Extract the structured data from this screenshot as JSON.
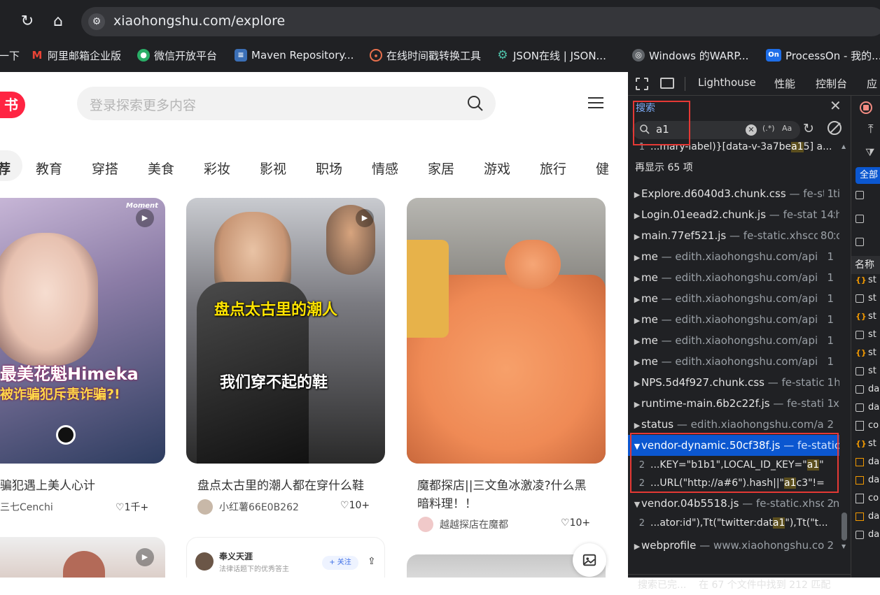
{
  "browser": {
    "url": "xiaohongshu.com/explore",
    "bookmarks": [
      {
        "label": "一下",
        "icon": "bookmark-icon"
      },
      {
        "label": "阿里邮箱企业版",
        "icon": "mail-icon"
      },
      {
        "label": "微信开放平台",
        "icon": "wechat-icon"
      },
      {
        "label": "Maven Repository...",
        "icon": "maven-icon"
      },
      {
        "label": "在线时间戳转换工具",
        "icon": "clock-icon"
      },
      {
        "label": "JSON在线 | JSON...",
        "icon": "json-icon"
      },
      {
        "label": "Windows 的WARP...",
        "icon": "globe-icon"
      },
      {
        "label": "ProcessOn - 我的...",
        "icon": "processon-icon"
      }
    ]
  },
  "site": {
    "logo": "书",
    "search_placeholder": "登录探索更多内容",
    "categories": [
      "荐",
      "教育",
      "穿搭",
      "美食",
      "彩妆",
      "影视",
      "职场",
      "情感",
      "家居",
      "游戏",
      "旅行",
      "健"
    ],
    "cards": [
      {
        "title": "骗犯遇上美人心计",
        "author": "三七Cenchi",
        "likes": "1千+",
        "img_caption_1": "最美花魁Himeka",
        "img_caption_2": "被诈骗犯斥责诈骗?!",
        "tag": "Moment"
      },
      {
        "title": "盘点太古里的潮人都在穿什么鞋",
        "author": "小红薯66E0B262",
        "likes": "10+",
        "img_caption_1": "盘点太古里的潮人",
        "img_caption_2": "我们穿不起的鞋"
      },
      {
        "title_line1": "魔都探店||三文鱼冰激凌?什么黑",
        "title_line2": "暗料理！！",
        "author": "越越探店在魔都",
        "likes": "10+"
      }
    ],
    "promo": {
      "author": "奉义天涯",
      "subtitle": "法律话题下的优秀答主",
      "follow": "+ 关注"
    }
  },
  "devtools": {
    "tabs": [
      "Lighthouse",
      "性能",
      "控制台",
      "应"
    ],
    "search": {
      "title": "搜索",
      "query": "a1",
      "regex_label": "(.*)",
      "case_label": "Aa",
      "top_match": {
        "line": "1",
        "pre": "...mary-label)}[data-v-3a7be",
        "hit": "a1",
        "post": "5] a..."
      },
      "more_label": "再显示 65 项",
      "files": [
        {
          "name": "Explore.d6040d3.chunk.css",
          "url": "— fe-static.xhscdn.com",
          "count": "1"
        },
        {
          "name": "Login.01eead2.chunk.js",
          "url": "— fe-static.xhscdn.com",
          "count": "14"
        },
        {
          "name": "main.77ef521.js",
          "url": "— fe-static.xhscdn.com",
          "count": "80"
        },
        {
          "name": "me",
          "url": "— edith.xiaohongshu.com/api",
          "count": "1"
        },
        {
          "name": "me",
          "url": "— edith.xiaohongshu.com/api",
          "count": "1"
        },
        {
          "name": "me",
          "url": "— edith.xiaohongshu.com/api",
          "count": "1"
        },
        {
          "name": "me",
          "url": "— edith.xiaohongshu.com/api",
          "count": "1"
        },
        {
          "name": "me",
          "url": "— edith.xiaohongshu.com/api",
          "count": "1"
        },
        {
          "name": "me",
          "url": "— edith.xiaohongshu.com/api",
          "count": "1"
        },
        {
          "name": "NPS.5d4f927.chunk.css",
          "url": "— fe-static.xhscdn.com",
          "count": "1"
        },
        {
          "name": "runtime-main.6b2c22f.js",
          "url": "— fe-static.xhscdn.com",
          "count": "1"
        },
        {
          "name": "status",
          "url": "— edith.xiaohongshu.com/api",
          "count": "2"
        }
      ],
      "selected_file": {
        "name": "vendor-dynamic.50cf38f.js",
        "url": "— fe-static.xhscdn.com"
      },
      "selected_matches": [
        {
          "line": "2",
          "pre": "...KEY=\"b1b1\",LOCAL_ID_KEY=\"",
          "hit": "a1",
          "post": "\""
        },
        {
          "line": "2",
          "pre": "...URL(\"http://a#6\").hash||\"",
          "hit": "a1",
          "post": "c3\"!="
        }
      ],
      "vendor_file": {
        "name": "vendor.04b5518.js",
        "url": "— fe-static.xhscdn.com",
        "count": "2"
      },
      "vendor_match": {
        "line": "2",
        "pre": "...ator:id\"),Tt(\"twitter:dat",
        "hit": "a1",
        "post": "\"),Tt(\"t..."
      },
      "last_file": {
        "name": "webprofile",
        "url": "— www.xiaohongshu.com",
        "count": "2"
      },
      "status_left": "搜索已完...",
      "status_right": "在 67 个文件中找到 212 匹配"
    },
    "network": {
      "filter_all": "全部",
      "name_header": "名称",
      "items": [
        "st",
        "st",
        "st",
        "st",
        "st",
        "st",
        "da",
        "da",
        "co",
        "st",
        "da",
        "da",
        "co",
        "da",
        "da"
      ]
    }
  }
}
